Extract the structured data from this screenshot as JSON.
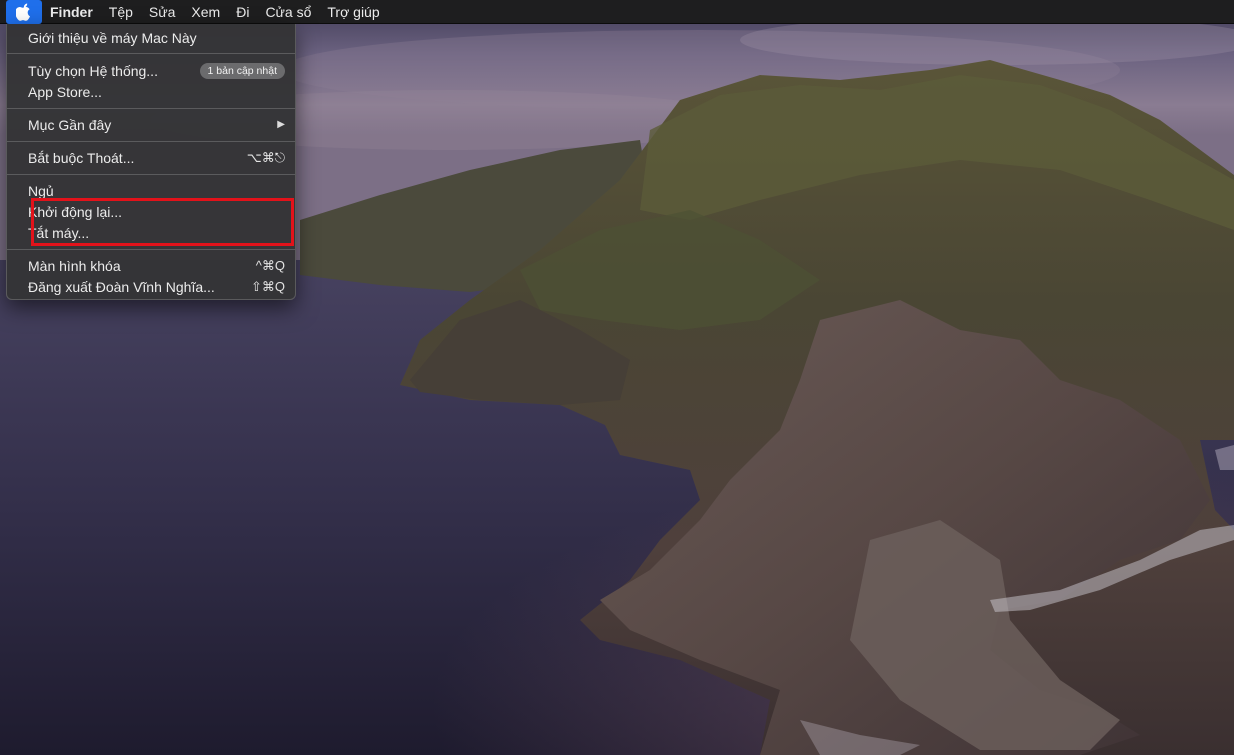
{
  "menubar": {
    "apple_icon": "apple-logo-icon",
    "app_name": "Finder",
    "menus": [
      "Tệp",
      "Sửa",
      "Xem",
      "Đi",
      "Cửa sổ",
      "Trợ giúp"
    ]
  },
  "apple_menu": {
    "about": "Giới thiệu về máy Mac Này",
    "system_prefs": "Tùy chọn Hệ thống...",
    "system_prefs_badge": "1 bản cập nhật",
    "app_store": "App Store...",
    "recent_items": "Mục Gần đây",
    "recent_items_arrow": "▶",
    "force_quit": "Bắt buộc Thoát...",
    "force_quit_shortcut": "⌥⌘⎋",
    "sleep": "Ngủ",
    "restart": "Khởi động lại...",
    "shutdown": "Tắt máy...",
    "lock_screen": "Màn hình khóa",
    "lock_screen_shortcut": "^⌘Q",
    "logout": "Đăng xuất Đoàn Vĩnh Nghĩa...",
    "logout_shortcut": "⇧⌘Q"
  },
  "colors": {
    "menubar_bg": "#1e1e1f",
    "menu_bg": "#343436",
    "apple_highlight": "#1f6feb",
    "annotation_red": "#e3121a"
  },
  "wallpaper": "macOS Catalina island wallpaper"
}
